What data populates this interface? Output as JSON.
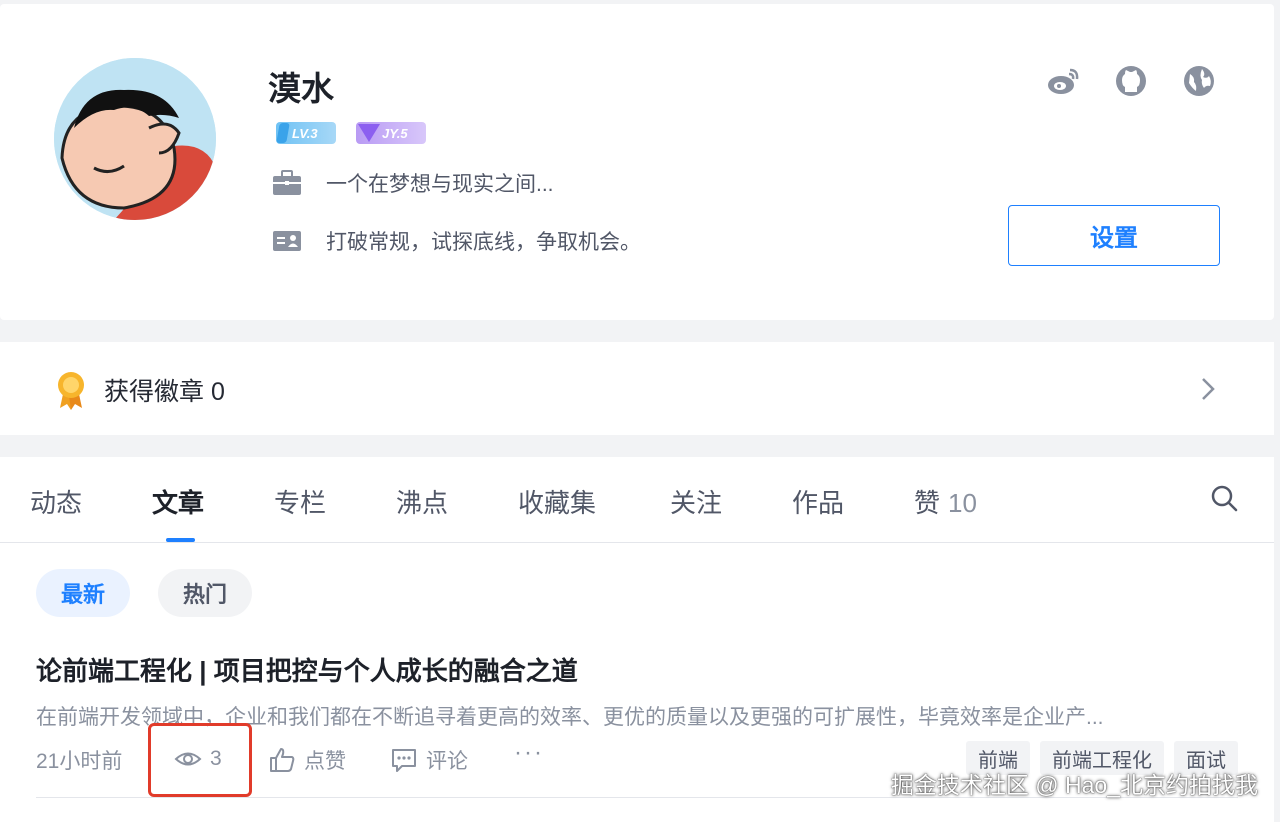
{
  "profile": {
    "username": "漠水",
    "level_badge": "LV.3",
    "jy_badge": "JY.5",
    "job": "一个在梦想与现实之间...",
    "description": "打破常规，试探底线，争取机会。",
    "setting_label": "设置",
    "social_icons": [
      "weibo-icon",
      "github-icon",
      "website-icon"
    ]
  },
  "badges": {
    "label": "获得徽章 0"
  },
  "tabs": [
    {
      "label": "动态"
    },
    {
      "label": "文章",
      "active": true
    },
    {
      "label": "专栏"
    },
    {
      "label": "沸点"
    },
    {
      "label": "收藏集"
    },
    {
      "label": "关注"
    },
    {
      "label": "作品"
    },
    {
      "label": "赞",
      "count": "10"
    }
  ],
  "filters": {
    "newest": "最新",
    "hot": "热门"
  },
  "article": {
    "title": "论前端工程化 | 项目把控与个人成长的融合之道",
    "abstract": "在前端开发领域中，企业和我们都在不断追寻着更高的效率、更优的质量以及更强的可扩展性，毕竟效率是企业产...",
    "time": "21小时前",
    "views": "3",
    "like_label": "点赞",
    "comment_label": "评论",
    "more": "···",
    "tags": [
      "前端",
      "前端工程化",
      "面试"
    ]
  },
  "watermark": "掘金技术社区 @ Hao_北京约拍找我",
  "colors": {
    "accent": "#1e80ff",
    "highlight": "#e13b2a"
  }
}
